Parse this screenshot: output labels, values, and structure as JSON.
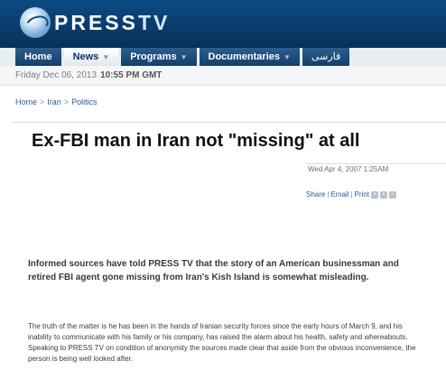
{
  "header": {
    "logo_press": "PRESS",
    "logo_tv": "TV",
    "brand_color": "#0a3c6d"
  },
  "nav": {
    "items": [
      {
        "label": "Home",
        "has_dropdown": false,
        "active": false
      },
      {
        "label": "News",
        "has_dropdown": true,
        "active": true
      },
      {
        "label": "Programs",
        "has_dropdown": true,
        "active": false
      },
      {
        "label": "Documentaries",
        "has_dropdown": true,
        "active": false
      },
      {
        "label": "فارسی",
        "has_dropdown": false,
        "active": false
      }
    ]
  },
  "dateline": {
    "date": "Friday Dec 06, 2013",
    "time": "10:55 PM GMT"
  },
  "breadcrumb": [
    "Home",
    "Iran",
    "Politics"
  ],
  "article": {
    "title": "Ex-FBI man in Iran not \"missing\" at all",
    "published": "Wed Apr 4, 2007 1:25AM",
    "share": {
      "share_label": "Share",
      "email_label": "Email",
      "print_label": "Print",
      "icons": [
        "plus-icon",
        "dot-icon",
        "minus-icon"
      ]
    },
    "lead": "Informed sources have told PRESS TV that the story of an American businessman and retired FBI agent gone missing from Iran's Kish Island is somewhat misleading.",
    "body": "The truth of the matter is he has been in the hands of Iranian security forces since the early hours of March 9, and his inability to communicate with his family or his company, has raised the alarm about his health, safety and whereabouts. Speaking to PRESS TV on condition of anonymity the sources made clear that aside from the obvious inconvenience, the person is being well looked after."
  }
}
